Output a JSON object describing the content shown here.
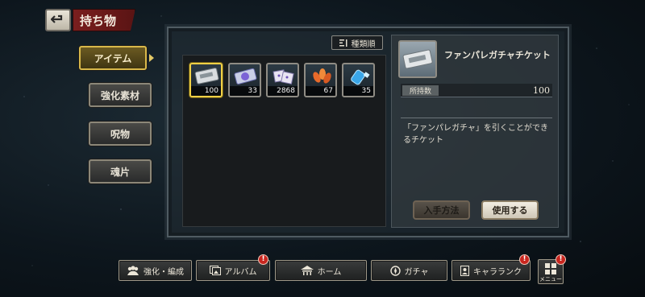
{
  "header": {
    "title": "持ち物"
  },
  "tabs": [
    {
      "label": "アイテム",
      "active": true
    },
    {
      "label": "強化素材",
      "active": false
    },
    {
      "label": "呪物",
      "active": false
    },
    {
      "label": "魂片",
      "active": false
    }
  ],
  "toolbar": {
    "sort_label": "種類順"
  },
  "items": [
    {
      "count": "100",
      "icon": "ticket-icon",
      "selected": true
    },
    {
      "count": "33",
      "icon": "crystal-ticket-icon",
      "selected": false
    },
    {
      "count": "2868",
      "icon": "dice-icon",
      "selected": false
    },
    {
      "count": "67",
      "icon": "petal-icon",
      "selected": false
    },
    {
      "count": "35",
      "icon": "blue-vial-icon",
      "selected": false
    }
  ],
  "detail": {
    "name": "ファンパレガチャチケット",
    "quantity_label": "所持数",
    "quantity_value": "100",
    "description": "「ファンパレガチャ」を引くことができるチケット",
    "acquire_label": "入手方法",
    "use_label": "使用する"
  },
  "nav": {
    "enhance_label": "強化・編成",
    "album_label": "アルバム",
    "home_label": "ホーム",
    "gacha_label": "ガチャ",
    "character_label": "キャラランク",
    "menu_label": "メニュー",
    "badge_text": "!"
  },
  "colors": {
    "accent_gold": "#f0d046",
    "header_red": "#7a1e1e",
    "badge_red": "#c8261f"
  }
}
